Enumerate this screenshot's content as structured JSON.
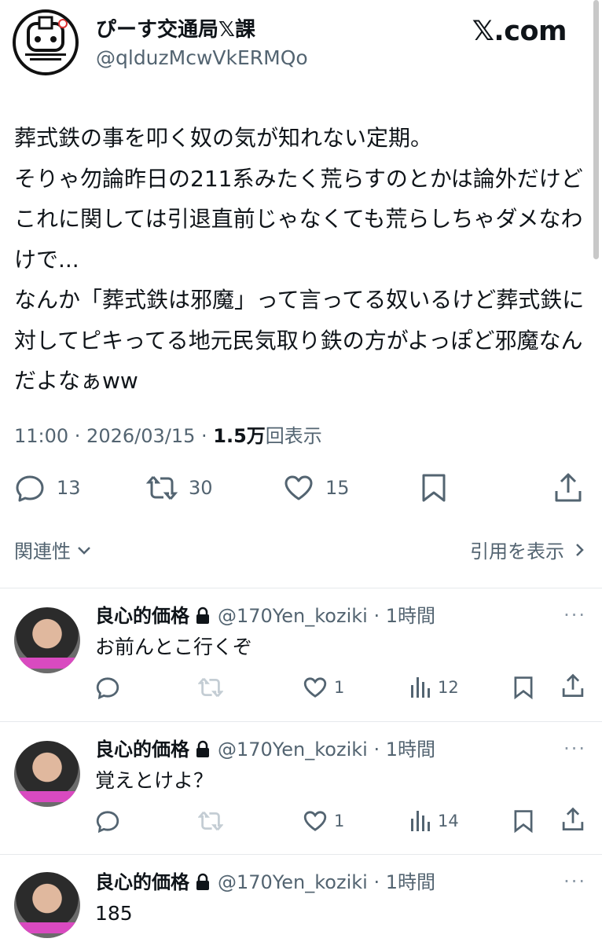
{
  "brand": {
    "label": "𝕏.com"
  },
  "tweet": {
    "author_name": "ぴーす交通局𝕏課",
    "author_handle": "@qlduzMcwVkERMQo",
    "text": "葬式鉄の事を叩く奴の気が知れない定期。\nそりゃ勿論昨日の211系みたく荒らすのとかは論外だけどこれに関しては引退直前じゃなくても荒らしちゃダメなわけで...\nなんか「葬式鉄は邪魔」って言ってる奴いるけど葬式鉄に対してピキってる地元民気取り鉄の方がよっぽど邪魔なんだよなぁww",
    "time": "11:00 · 2026/03/15 · ",
    "views_count": "1.5万",
    "views_label": "回表示",
    "replies": "13",
    "retweets": "30",
    "likes": "15"
  },
  "related": {
    "left_label": "関連性",
    "right_label": "引用を表示"
  },
  "replies": [
    {
      "name": "良心的価格",
      "handle": "@170Yen_koziki · 1時間",
      "text": "お前んとこ行くぞ",
      "likes": "1",
      "views": "12"
    },
    {
      "name": "良心的価格",
      "handle": "@170Yen_koziki · 1時間",
      "text": "覚えとけよ？",
      "likes": "1",
      "views": "14"
    },
    {
      "name": "良心的価格",
      "handle": "@170Yen_koziki · 1時間",
      "text": "185"
    }
  ],
  "icons": [
    "reply-icon",
    "retweet-icon",
    "like-icon",
    "bookmark-icon",
    "share-icon",
    "views-icon",
    "lock-icon",
    "more-icon",
    "chevron-down-icon",
    "chevron-right-icon"
  ],
  "colors": {
    "text": "#0f1419",
    "muted": "#536471",
    "divider": "#e6e9ec"
  }
}
